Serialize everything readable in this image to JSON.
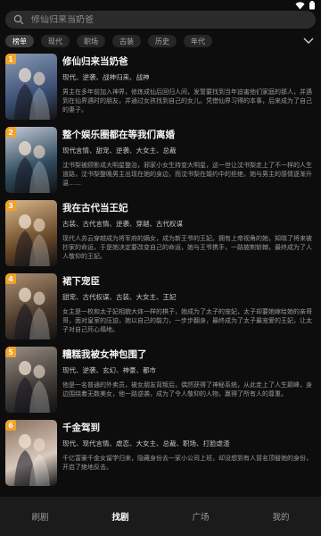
{
  "search": {
    "placeholder": "修仙归来当奶爸"
  },
  "tabs": [
    {
      "label": "榜单",
      "active": true
    },
    {
      "label": "现代",
      "active": false
    },
    {
      "label": "职场",
      "active": false
    },
    {
      "label": "古装",
      "active": false
    },
    {
      "label": "历史",
      "active": false
    },
    {
      "label": "年代",
      "active": false
    }
  ],
  "items": [
    {
      "rank": "1",
      "title": "修仙归来当奶爸",
      "tags": "现代、逆袭、战神归来、战神",
      "desc": "男主在多年前加入神界，修炼成仙后回归人间，发誓要找到当年迫害他们家庭的那人，并遇到在仙界遇时的朋友，并通过女孩找到自己的女儿。凭借仙界习得的本事，后来成为了自己的妻子。",
      "accent": "#3b4f73",
      "accent2": "#8b9bb8"
    },
    {
      "rank": "2",
      "title": "整个娱乐圈都在等我们离婚",
      "tags": "现代言情、甜宠、逆袭、大女主、总裁",
      "desc": "沈书梨被顾影成大明星整治，邪家小女生持变大明星，这一世让沈书梨走上了不一样的人生道路，沈书梨整晚男主出现在她的身边，而沈书梨在婚约中的拒绝，她与男主的感情逐渐升温……",
      "accent": "#2f4a5e",
      "accent2": "#c6ccd6"
    },
    {
      "rank": "3",
      "title": "我在古代当王妃",
      "tags": "古装、古代言情、逆袭、穿越、古代权谋",
      "desc": "现代人苏云穿越成为将军府的嫡女，成为新王爷的王妃。拥有上帝视角的她，知晓了将来被抄家的命运，于是她决定要改变自己的命运，她与王爷携手，一路披荆斩棘，最终成为了人人敬仰的王妃。",
      "accent": "#6b4a2a",
      "accent2": "#d9b98a"
    },
    {
      "rank": "4",
      "title": "裙下宠臣",
      "tags": "甜宠、古代权谋、古装、大女主、王妃",
      "desc": "女主是一枚和太子妃相貌大体一样的棋子，她成为了太子的宠妃，太子却要她嫁给她的亲哥哥，面对皇室的压迫，她以自己的能力，一步步翻身，最终成为了太子最宠爱的王妃，让太子对自己死心塌地。",
      "accent": "#4a3a2e",
      "accent2": "#b09070"
    },
    {
      "rank": "5",
      "title": "糟糕我被女神包围了",
      "tags": "现代、逆袭、玄幻、神豪、都市",
      "desc": "他是一名普通的外卖员，被女朋友背叛后，偶然获得了神秘系统，从此走上了人生巅峰，身边围绕着无数美女，他一路逆袭，成为了令人敬仰的人物，赢得了所有人的尊重。",
      "accent": "#3e3a36",
      "accent2": "#9a8f84"
    },
    {
      "rank": "6",
      "title": "千金驾到",
      "tags": "现代、现代言情、虐恋、大女主、总裁、职场、打脸虐渣",
      "desc": "千亿富豪千金女留学归来，隐藏身份去一家小公司上班，却没想到有人冒名顶替她的身份，开启了绝地反击。",
      "accent": "#d8c9bd",
      "accent2": "#8a6f5e"
    }
  ],
  "nav": [
    {
      "label": "刷剧",
      "active": false
    },
    {
      "label": "找剧",
      "active": true
    },
    {
      "label": "广场",
      "active": false
    },
    {
      "label": "我的",
      "active": false
    }
  ]
}
